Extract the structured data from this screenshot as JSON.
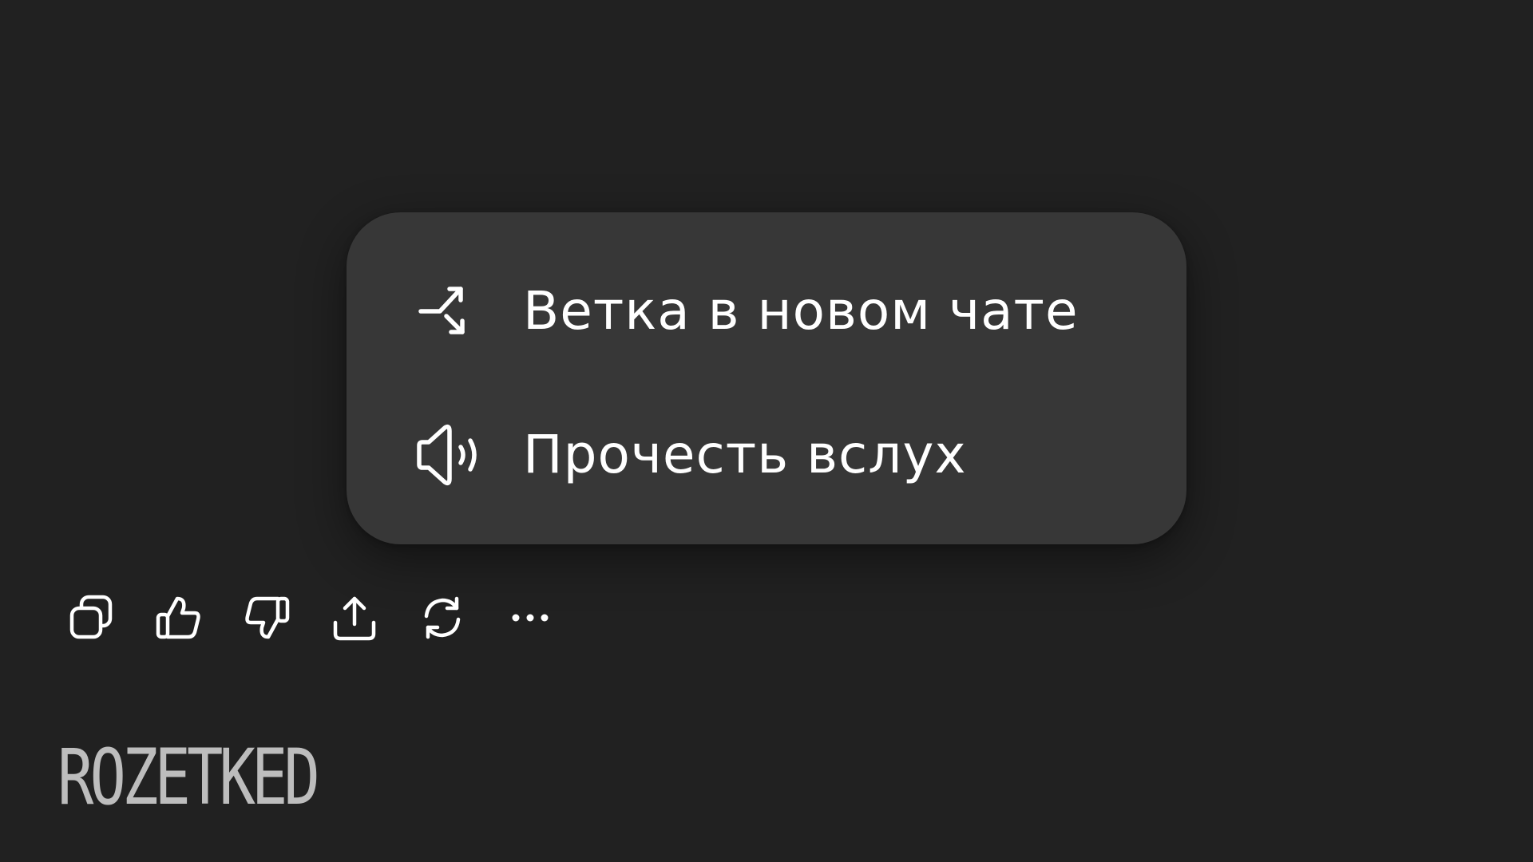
{
  "context_menu": {
    "items": [
      {
        "label": "Ветка в новом чате",
        "icon": "branch-arrows-icon"
      },
      {
        "label": "Прочесть вслух",
        "icon": "speaker-icon"
      }
    ]
  },
  "toolbar": {
    "buttons": [
      {
        "icon": "copy-icon"
      },
      {
        "icon": "thumbs-up-icon"
      },
      {
        "icon": "thumbs-down-icon"
      },
      {
        "icon": "share-icon"
      },
      {
        "icon": "regenerate-icon"
      },
      {
        "icon": "more-icon"
      }
    ]
  },
  "watermark": {
    "text": "ROZETKED"
  },
  "colors": {
    "background": "#212121",
    "menu_background": "#373737",
    "text": "#ffffff",
    "watermark": "#bdbdbd"
  }
}
